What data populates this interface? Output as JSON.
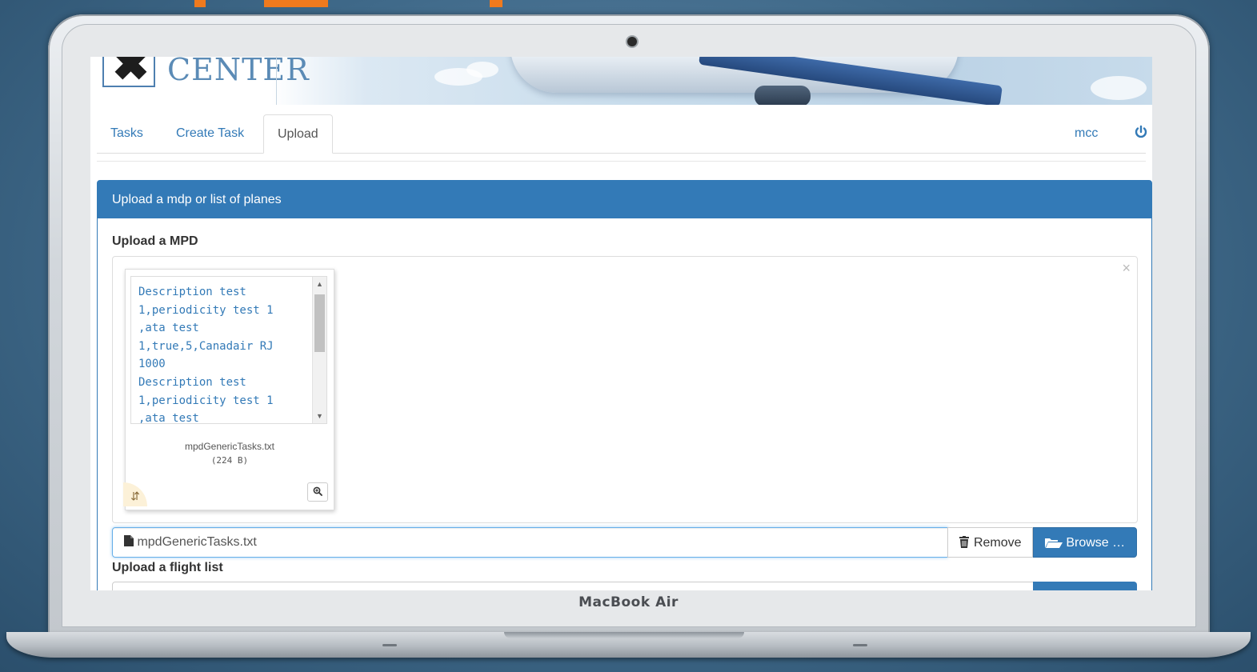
{
  "device": {
    "brand_label": "MacBook Air"
  },
  "header": {
    "logo_mark": "✖",
    "logo_text": "CENTER"
  },
  "nav": {
    "tabs": [
      {
        "label": "Tasks"
      },
      {
        "label": "Create Task"
      },
      {
        "label": "Upload",
        "active": true
      }
    ],
    "user_label": "mcc",
    "power_icon": "power-icon"
  },
  "panel": {
    "heading": "Upload a mdp or list of planes",
    "mpd_section": {
      "label": "Upload a MPD",
      "close_glyph": "×",
      "preview": {
        "content": "Description test 1,periodicity test 1 ,ata test 1,true,5,Canadair RJ 1000\nDescription test 1,periodicity test 1 ,ata test",
        "file_name": "mpdGenericTasks.txt",
        "file_size": "(224 B)"
      },
      "caption_value": "mpdGenericTasks.txt",
      "remove_label": "Remove",
      "browse_label": "Browse …"
    },
    "flight_section": {
      "label": "Upload a flight list"
    }
  },
  "colors": {
    "primary": "#337ab7",
    "accent_strip": "#f07a1e"
  }
}
